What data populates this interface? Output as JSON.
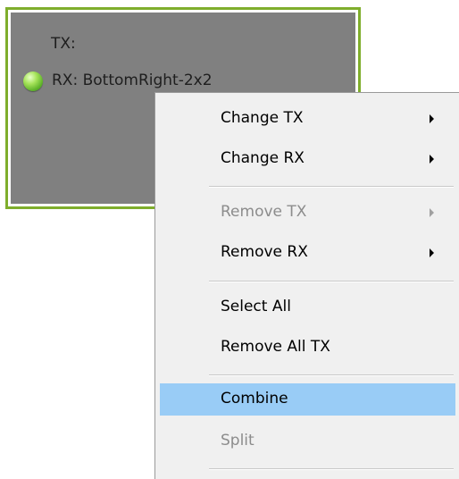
{
  "tile": {
    "tx_label": "TX:",
    "rx_label": "RX: BottomRight-2x2",
    "status_color": "#7fc93a",
    "border_color": "#7fae2c"
  },
  "menu": {
    "items": [
      {
        "label": "Change TX",
        "enabled": true,
        "submenu": true
      },
      {
        "label": "Change RX",
        "enabled": true,
        "submenu": true
      },
      {
        "label": "Remove TX",
        "enabled": false,
        "submenu": true
      },
      {
        "label": "Remove RX",
        "enabled": true,
        "submenu": true
      },
      {
        "label": "Select All",
        "enabled": true,
        "submenu": false
      },
      {
        "label": "Remove All TX",
        "enabled": true,
        "submenu": false
      },
      {
        "label": "Combine",
        "enabled": true,
        "submenu": false,
        "highlighted": true
      },
      {
        "label": "Split",
        "enabled": false,
        "submenu": false
      }
    ],
    "highlight_color": "#99ccf6"
  }
}
